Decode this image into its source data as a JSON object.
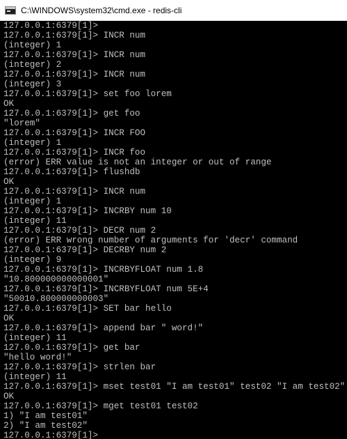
{
  "window": {
    "title": "C:\\WINDOWS\\system32\\cmd.exe - redis-cli",
    "icon": "cmd-icon"
  },
  "console": {
    "lines": [
      "127.0.0.1:6379[1]>",
      "127.0.0.1:6379[1]> INCR num",
      "(integer) 1",
      "127.0.0.1:6379[1]> INCR num",
      "(integer) 2",
      "127.0.0.1:6379[1]> INCR num",
      "(integer) 3",
      "127.0.0.1:6379[1]> set foo lorem",
      "OK",
      "127.0.0.1:6379[1]> get foo",
      "\"lorem\"",
      "127.0.0.1:6379[1]> INCR FOO",
      "(integer) 1",
      "127.0.0.1:6379[1]> INCR foo",
      "(error) ERR value is not an integer or out of range",
      "127.0.0.1:6379[1]> flushdb",
      "OK",
      "127.0.0.1:6379[1]> INCR num",
      "(integer) 1",
      "127.0.0.1:6379[1]> INCRBY num 10",
      "(integer) 11",
      "127.0.0.1:6379[1]> DECR num 2",
      "(error) ERR wrong number of arguments for 'decr' command",
      "127.0.0.1:6379[1]> DECRBY num 2",
      "(integer) 9",
      "127.0.0.1:6379[1]> INCRBYFLOAT num 1.8",
      "\"10.800000000000001\"",
      "127.0.0.1:6379[1]> INCRBYFLOAT num 5E+4",
      "\"50010.800000000003\"",
      "127.0.0.1:6379[1]> SET bar hello",
      "OK",
      "127.0.0.1:6379[1]> append bar \" word!\"",
      "(integer) 11",
      "127.0.0.1:6379[1]> get bar",
      "\"hello word!\"",
      "127.0.0.1:6379[1]> strlen bar",
      "(integer) 11",
      "127.0.0.1:6379[1]> mset test01 \"I am test01\" test02 \"I am test02\"",
      "OK",
      "127.0.0.1:6379[1]> mget test01 test02",
      "1) \"I am test01\"",
      "2) \"I am test02\"",
      "127.0.0.1:6379[1]>"
    ]
  },
  "colors": {
    "background": "#000000",
    "text": "#c0c0c0",
    "titlebar": "#ffffff"
  }
}
